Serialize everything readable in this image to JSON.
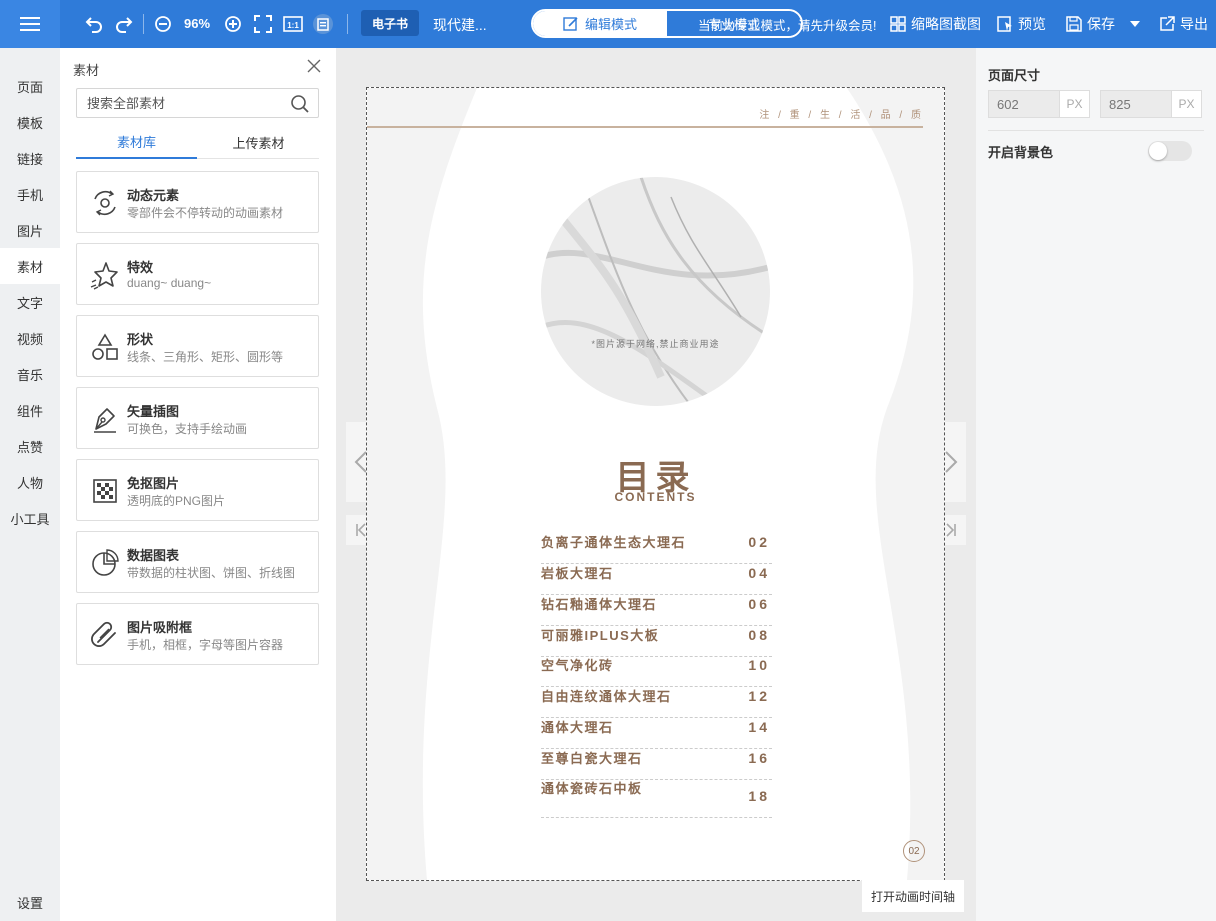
{
  "toolbar": {
    "zoom": "96%",
    "ebook_tag": "电子书",
    "doc_title": "现代建...",
    "mode_edit": "编辑模式",
    "mode_other": "专业模式",
    "notice": "当前为专业模式，请先升级会员!",
    "thumb_label": "缩略图截图",
    "preview_label": "预览",
    "save_label": "保存",
    "export_label": "导出",
    "icons": [
      "menu-icon",
      "undo-icon",
      "redo-icon",
      "zoom-out-icon",
      "zoom-in-icon",
      "fullscreen-icon",
      "actual-size-icon",
      "clipboard-icon"
    ]
  },
  "nav": {
    "items": [
      {
        "label": "页面"
      },
      {
        "label": "模板"
      },
      {
        "label": "链接"
      },
      {
        "label": "手机"
      },
      {
        "label": "图片"
      },
      {
        "label": "素材",
        "active": true
      },
      {
        "label": "文字"
      },
      {
        "label": "视频"
      },
      {
        "label": "音乐"
      },
      {
        "label": "组件"
      },
      {
        "label": "点赞"
      },
      {
        "label": "人物"
      },
      {
        "label": "小工具"
      }
    ],
    "settings": "设置"
  },
  "panel": {
    "title": "素材",
    "search_placeholder": "搜索全部素材",
    "tabs": [
      {
        "label": "素材库",
        "active": true
      },
      {
        "label": "上传素材"
      }
    ],
    "cards": [
      {
        "title": "动态元素",
        "desc": "零部件会不停转动的动画素材",
        "icon": "gears-icon"
      },
      {
        "title": "特效",
        "desc": "duang~ duang~",
        "icon": "star-effect-icon"
      },
      {
        "title": "形状",
        "desc": "线条、三角形、矩形、圆形等",
        "icon": "shapes-icon"
      },
      {
        "title": "矢量插图",
        "desc": "可换色，支持手绘动画",
        "icon": "pen-icon"
      },
      {
        "title": "免抠图片",
        "desc": "透明底的PNG图片",
        "icon": "checkerboard-icon"
      },
      {
        "title": "数据图表",
        "desc": "带数据的柱状图、饼图、折线图",
        "icon": "pie-chart-icon"
      },
      {
        "title": "图片吸附框",
        "desc": "手机，相框，字母等图片容器",
        "icon": "magnet-icon"
      }
    ]
  },
  "page": {
    "slogan": "注 / 重 / 生 / 活 / 品 / 质",
    "image_caption": "*图片源于网络,禁止商业用途",
    "toc_title": "目录",
    "toc_subtitle": "CONTENTS",
    "toc": [
      {
        "name": "负离子通体生态大理石",
        "num": "02"
      },
      {
        "name": "岩板大理石",
        "num": "04"
      },
      {
        "name": "钻石釉通体大理石",
        "num": "06"
      },
      {
        "name": "可丽雅IPLUS大板",
        "num": "08"
      },
      {
        "name": "空气净化砖",
        "num": "10"
      },
      {
        "name": "自由连纹通体大理石",
        "num": "12"
      },
      {
        "name": "通体大理石",
        "num": "14"
      },
      {
        "name": "至尊白瓷大理石",
        "num": "16"
      },
      {
        "name": "通体瓷砖石中板",
        "num": "18"
      }
    ],
    "page_number": "02"
  },
  "timeline_btn": "打开动画时间轴",
  "props": {
    "title": "页面尺寸",
    "width": "602",
    "height": "825",
    "unit": "PX",
    "bg_label": "开启背景色",
    "bg_enabled": false
  },
  "colors": {
    "accent": "#2f7bd9",
    "toc_brown": "#8a6a52"
  }
}
